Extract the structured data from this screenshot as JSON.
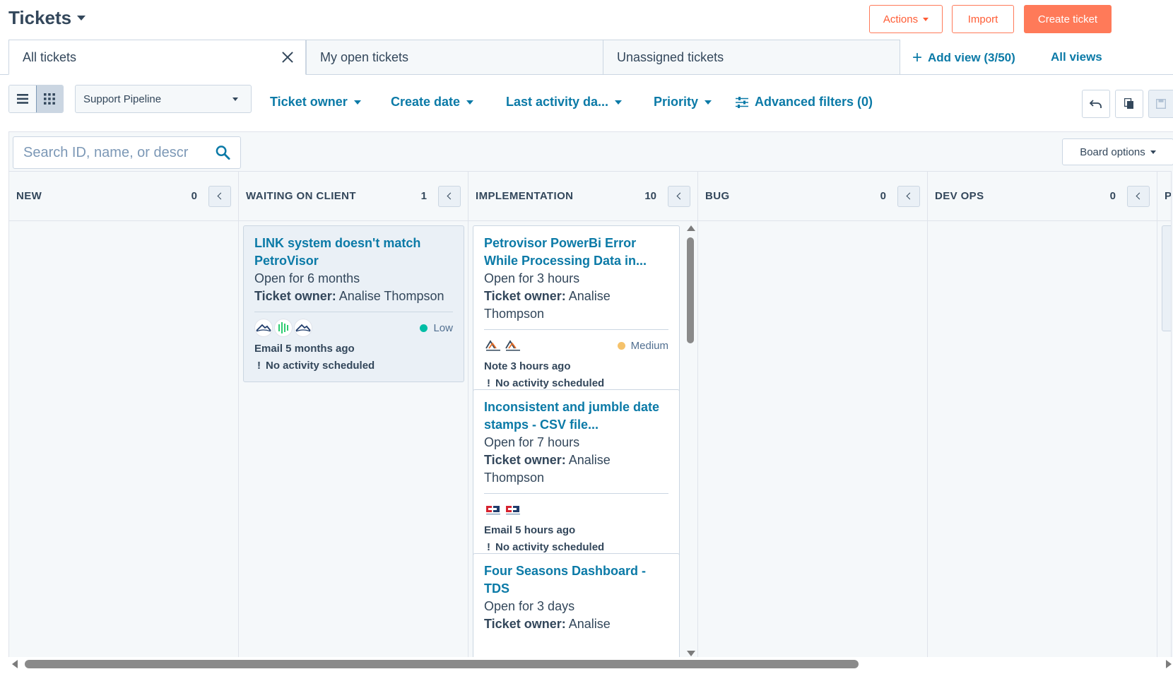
{
  "header": {
    "title": "Tickets",
    "actions_label": "Actions",
    "import_label": "Import",
    "create_label": "Create ticket"
  },
  "views": {
    "tabs": [
      {
        "label": "All tickets",
        "active": true
      },
      {
        "label": "My open tickets",
        "active": false
      },
      {
        "label": "Unassigned tickets",
        "active": false
      }
    ],
    "add_view_label": "Add view (3/50)",
    "all_views_label": "All views"
  },
  "filters": {
    "pipeline": "Support Pipeline",
    "dropdowns": [
      "Ticket owner",
      "Create date",
      "Last activity da...",
      "Priority"
    ],
    "advanced_label": "Advanced filters (0)"
  },
  "board": {
    "search_placeholder": "Search ID, name, or descr",
    "options_label": "Board options",
    "columns": [
      {
        "title": "NEW",
        "count": "0"
      },
      {
        "title": "WAITING ON CLIENT",
        "count": "1"
      },
      {
        "title": "IMPLEMENTATION",
        "count": "10"
      },
      {
        "title": "BUG",
        "count": "0"
      },
      {
        "title": "DEV OPS",
        "count": "0"
      },
      {
        "title": "P",
        "count": ""
      }
    ],
    "cards": {
      "waiting": [
        {
          "title_1": "LINK system doesn't match",
          "title_2": "PetroVisor",
          "open_for": "Open for 6 months",
          "owner_label": "Ticket owner:",
          "owner_name": "Analise Thompson",
          "priority": "Low",
          "priority_color": "#00bda5",
          "last_activity": "Email 5 months ago",
          "next_activity": "No activity scheduled"
        }
      ],
      "implementation": [
        {
          "title_1": "Petrovisor PowerBi Error",
          "title_2": "While Processing Data in...",
          "open_for": "Open for 3 hours",
          "owner_label": "Ticket owner:",
          "owner_name_1": "Analise",
          "owner_name_2": "Thompson",
          "priority": "Medium",
          "priority_color": "#f5c26b",
          "last_activity": "Note 3 hours ago",
          "next_activity": "No activity scheduled"
        },
        {
          "title_1": "Inconsistent and jumble date",
          "title_2": "stamps - CSV file...",
          "open_for": "Open for 7 hours",
          "owner_label": "Ticket owner:",
          "owner_name_1": "Analise",
          "owner_name_2": "Thompson",
          "last_activity": "Email 5 hours ago",
          "next_activity": "No activity scheduled"
        },
        {
          "title_1": "Four Seasons Dashboard -",
          "title_2": "TDS",
          "open_for": "Open for 3 days",
          "owner_label": "Ticket owner:",
          "owner_name_1": "Analise"
        }
      ]
    }
  },
  "colors": {
    "accent_orange": "#ff7a59",
    "link_blue": "#0b7aa7",
    "text_dark": "#33475b",
    "border": "#cbd6e2",
    "board_bg": "#f5f8fa"
  }
}
